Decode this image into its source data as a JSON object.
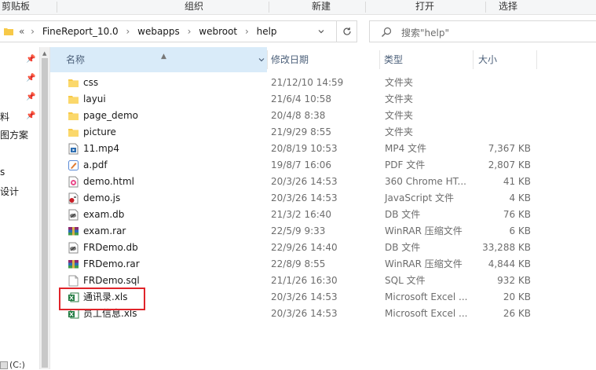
{
  "ribbon": {
    "groups": [
      "剪贴板",
      "组织",
      "新建",
      "打开",
      "选择"
    ]
  },
  "address": {
    "crumbs": [
      "«",
      "FineReport_10.0",
      "webapps",
      "webroot",
      "help"
    ]
  },
  "search": {
    "placeholder": "搜索\"help\""
  },
  "nav": {
    "items": [
      "料",
      "图方案",
      "s",
      "设计"
    ],
    "drive": "(C:)"
  },
  "columns": {
    "name": "名称",
    "date": "修改日期",
    "type": "类型",
    "size": "大小"
  },
  "files": [
    {
      "name": "css",
      "date": "21/12/10 14:59",
      "type": "文件夹",
      "size": "",
      "icon": "folder-icon"
    },
    {
      "name": "layui",
      "date": "21/6/4 10:58",
      "type": "文件夹",
      "size": "",
      "icon": "folder-icon"
    },
    {
      "name": "page_demo",
      "date": "20/4/8 8:38",
      "type": "文件夹",
      "size": "",
      "icon": "folder-icon"
    },
    {
      "name": "picture",
      "date": "21/9/29 8:55",
      "type": "文件夹",
      "size": "",
      "icon": "folder-icon"
    },
    {
      "name": "11.mp4",
      "date": "20/8/19 10:53",
      "type": "MP4 文件",
      "size": "7,367 KB",
      "icon": "video-file-icon"
    },
    {
      "name": "a.pdf",
      "date": "19/8/7 16:06",
      "type": "PDF 文件",
      "size": "2,807 KB",
      "icon": "pdf-file-icon"
    },
    {
      "name": "demo.html",
      "date": "20/3/26 14:53",
      "type": "360 Chrome HT...",
      "size": "41 KB",
      "icon": "browser-file-icon"
    },
    {
      "name": "demo.js",
      "date": "20/3/26 14:53",
      "type": "JavaScript 文件",
      "size": "4 KB",
      "icon": "script-file-icon"
    },
    {
      "name": "exam.db",
      "date": "21/3/2 16:40",
      "type": "DB 文件",
      "size": "76 KB",
      "icon": "db-file-icon"
    },
    {
      "name": "exam.rar",
      "date": "22/5/9 9:33",
      "type": "WinRAR 压缩文件",
      "size": "6 KB",
      "icon": "rar-file-icon"
    },
    {
      "name": "FRDemo.db",
      "date": "22/9/26 14:40",
      "type": "DB 文件",
      "size": "33,288 KB",
      "icon": "db-file-icon"
    },
    {
      "name": "FRDemo.rar",
      "date": "22/8/9 8:55",
      "type": "WinRAR 压缩文件",
      "size": "4,844 KB",
      "icon": "rar-file-icon"
    },
    {
      "name": "FRDemo.sql",
      "date": "21/1/26 16:30",
      "type": "SQL 文件",
      "size": "932 KB",
      "icon": "sql-file-icon"
    },
    {
      "name": "通讯录.xls",
      "date": "20/3/26 14:53",
      "type": "Microsoft Excel ...",
      "size": "20 KB",
      "icon": "excel-file-icon"
    },
    {
      "name": "员工信息.xls",
      "date": "20/3/26 14:53",
      "type": "Microsoft Excel ...",
      "size": "26 KB",
      "icon": "excel-file-icon"
    }
  ],
  "colors": {
    "highlight": "#e0242a",
    "folder": "#f7c948",
    "header_active": "#d9ebf9"
  }
}
